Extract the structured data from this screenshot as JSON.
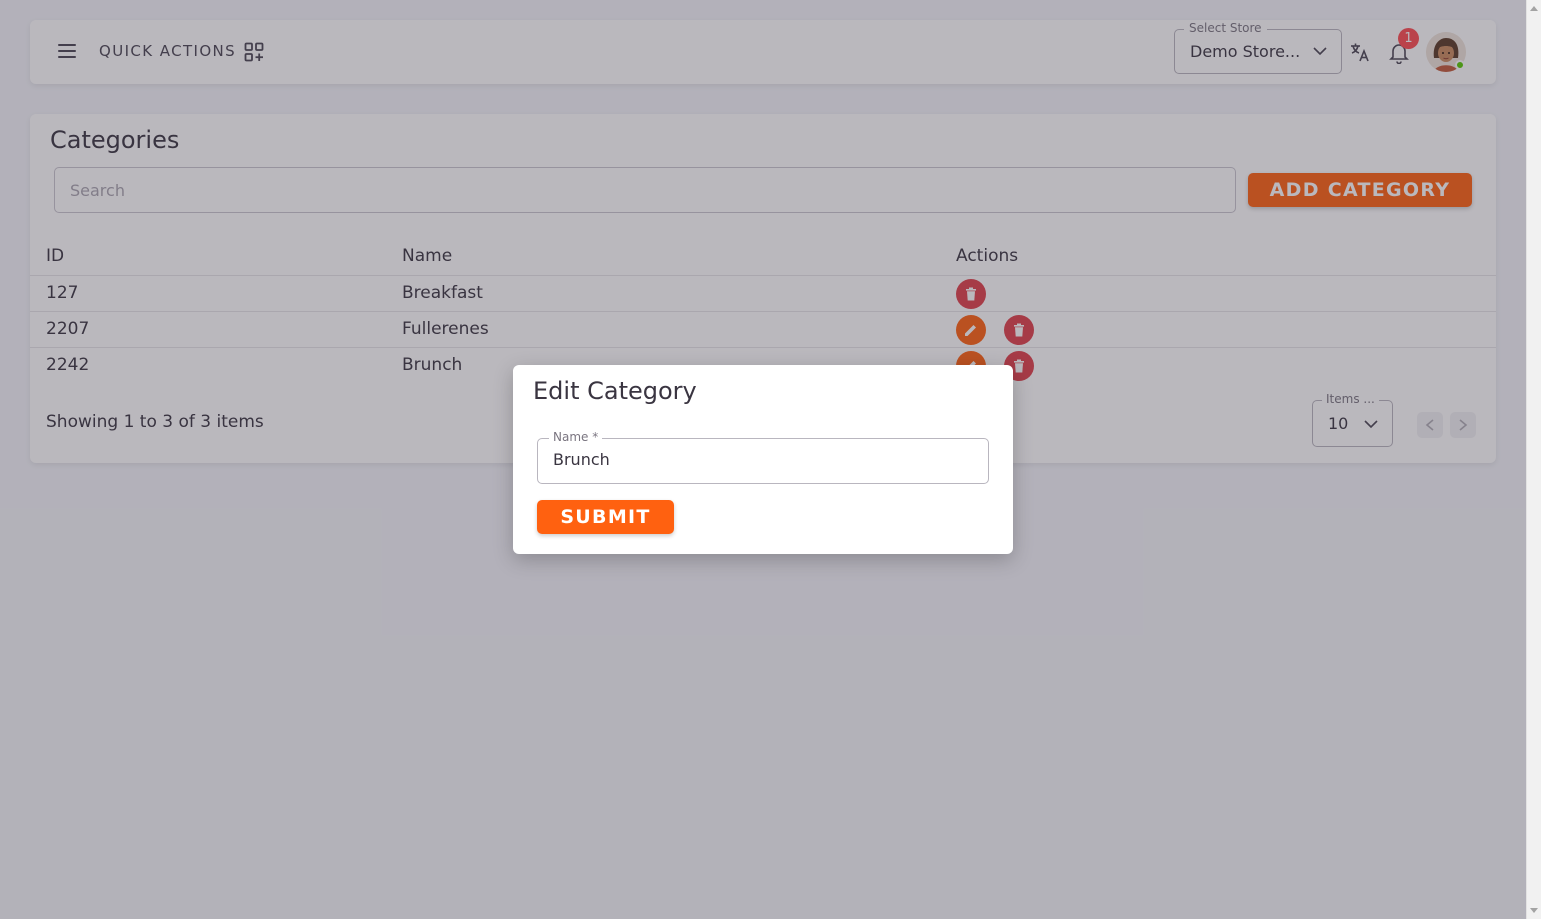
{
  "topbar": {
    "quick_actions_label": "QUICK ACTIONS",
    "store_select": {
      "legend": "Select Store",
      "value": "Demo Store..."
    },
    "notification_count": "1"
  },
  "categories": {
    "title": "Categories",
    "search_placeholder": "Search",
    "add_button_label": "ADD CATEGORY",
    "columns": [
      "ID",
      "Name",
      "Actions"
    ],
    "rows": [
      {
        "id": "127",
        "name": "Breakfast"
      },
      {
        "id": "2207",
        "name": "Fullerenes"
      },
      {
        "id": "2242",
        "name": "Brunch"
      }
    ],
    "showing_text": "Showing 1 to 3 of 3 items",
    "items_per_page": {
      "legend": "Items ...",
      "value": "10"
    }
  },
  "modal": {
    "title": "Edit Category",
    "name_legend": "Name *",
    "name_value": "Brunch",
    "submit_label": "SUBMIT"
  },
  "colors": {
    "primary": "#ff6110",
    "danger": "#e0404a",
    "online": "#56ca00",
    "badge": "#ff4c51"
  }
}
